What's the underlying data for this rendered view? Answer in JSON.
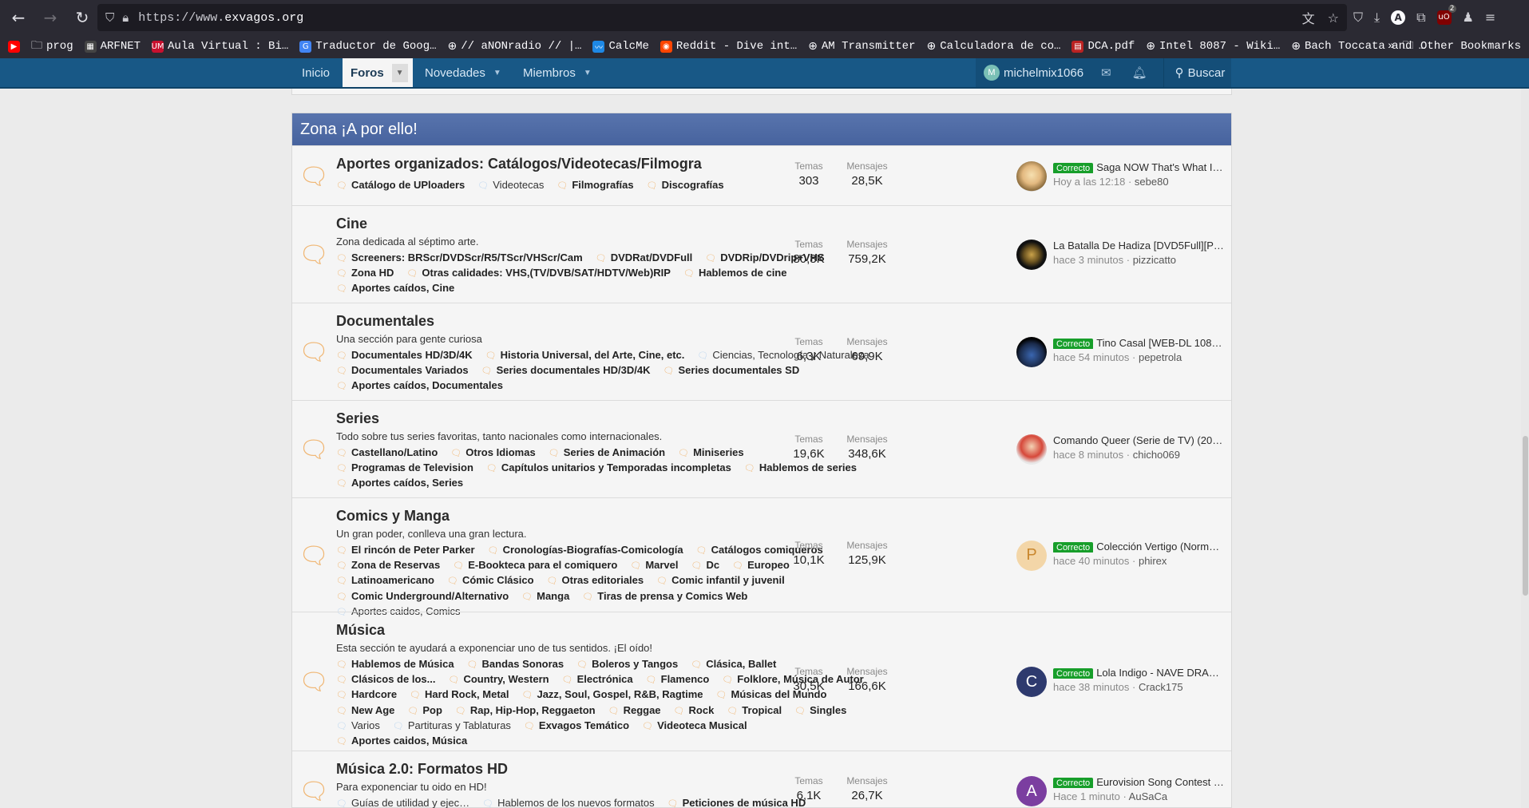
{
  "browser": {
    "url_prefix": "https://www.",
    "url_domain": "exvagos.org",
    "bookmarks": [
      "prog",
      "ARFNET",
      "Aula Virtual : Bi…",
      "Traductor de Goog…",
      "// aNONradio // |…",
      "CalcMe",
      "Reddit - Dive int…",
      "AM Transmitter",
      "Calculadora de co…",
      "DCA.pdf",
      "Intel 8087 - Wiki…",
      "Bach Toccata and …"
    ],
    "other_bookmarks": "Other Bookmarks",
    "ublock_count": "2"
  },
  "sitenav": {
    "home": "Inicio",
    "forums": "Foros",
    "news": "Novedades",
    "members": "Miembros",
    "username": "michelmix1066",
    "user_initial": "M",
    "search": "Buscar"
  },
  "block": {
    "title": "Zona ¡A por ello!",
    "stat_threads_label": "Temas",
    "stat_messages_label": "Mensajes",
    "prefix_label": "Correcto",
    "nodes": [
      {
        "title": "Aportes organizados: Catálogos/Videotecas/Filmogra",
        "desc": "",
        "subs": [
          [
            "Catálogo de UPloaders",
            true
          ],
          [
            "Videotecas",
            false
          ],
          [
            "Filmografías",
            true
          ],
          [
            "Discografías",
            true
          ]
        ],
        "threads": "303",
        "messages": "28,5K",
        "last_title": "Saga NOW That's What I…",
        "last_time": "Hoy a las 12:18",
        "last_user": "sebe80",
        "prefixed": true,
        "avatar": ""
      },
      {
        "title": "Cine",
        "desc": "Zona dedicada al séptimo arte.",
        "subs": [
          [
            "Screeners: BRScr/DVDScr/R5/TScr/VHScr/Cam",
            true
          ],
          [
            "DVDRat/DVDFull",
            true
          ],
          [
            "DVDRip/DVDrip+VHS",
            true
          ],
          [
            "Zona HD",
            true
          ],
          [
            "Otras calidades: VHS,(TV/DVB/SAT/HDTV/Web)RIP",
            true
          ],
          [
            "Hablemos de cine",
            true
          ],
          [
            "Aportes caídos, Cine",
            true
          ]
        ],
        "threads": "80,8K",
        "messages": "759,2K",
        "last_title": "La Batalla De Hadiza [DVD5Full][P…",
        "last_time": "hace 3 minutos",
        "last_user": "pizzicatto",
        "prefixed": false,
        "avatar": ""
      },
      {
        "title": "Documentales",
        "desc": "Una sección para gente curiosa",
        "subs": [
          [
            "Documentales HD/3D/4K",
            true
          ],
          [
            "Historia Universal, del Arte, Cine, etc.",
            true
          ],
          [
            "Ciencias, Tecnología y Naturaleza",
            false
          ],
          [
            "Documentales Variados",
            true
          ],
          [
            "Series documentales HD/3D/4K",
            true
          ],
          [
            "Series documentales SD",
            true
          ],
          [
            "Aportes caídos, Documentales",
            true
          ]
        ],
        "threads": "6,3K",
        "messages": "69,9K",
        "last_title": "Tino Casal [WEB-DL 108…",
        "last_time": "hace 54 minutos",
        "last_user": "pepetrola",
        "prefixed": true,
        "avatar": ""
      },
      {
        "title": "Series",
        "desc": "Todo sobre tus series favoritas, tanto nacionales como internacionales.",
        "subs": [
          [
            "Castellano/Latino",
            true
          ],
          [
            "Otros Idiomas",
            true
          ],
          [
            "Series de Animación",
            true
          ],
          [
            "Miniseries",
            true
          ],
          [
            "Programas de Television",
            true
          ],
          [
            "Capítulos unitarios y Temporadas incompletas",
            true
          ],
          [
            "Hablemos de series",
            true
          ],
          [
            "Aportes caídos, Series",
            true
          ]
        ],
        "threads": "19,6K",
        "messages": "348,6K",
        "last_title": "Comando Queer (Serie de TV) (20…",
        "last_time": "hace 8 minutos",
        "last_user": "chicho069",
        "prefixed": false,
        "avatar": ""
      },
      {
        "title": "Comics y Manga",
        "desc": "Un gran poder, conlleva una gran lectura.",
        "subs": [
          [
            "El rincón de Peter Parker",
            true
          ],
          [
            "Cronologías-Biografías-Comicología",
            true
          ],
          [
            "Catálogos comiqueros",
            true
          ],
          [
            "Zona de Reservas",
            true
          ],
          [
            "E-Bookteca para el comiquero",
            true
          ],
          [
            "Marvel",
            true
          ],
          [
            "Dc",
            true
          ],
          [
            "Europeo",
            true
          ],
          [
            "Latinoamericano",
            true
          ],
          [
            "Cómic Clásico",
            true
          ],
          [
            "Otras editoriales",
            true
          ],
          [
            "Comic infantil y juvenil",
            true
          ],
          [
            "Comic Underground/Alternativo",
            true
          ],
          [
            "Manga",
            true
          ],
          [
            "Tiras de prensa y Comics Web",
            true
          ],
          [
            "Aportes caidos, Comics",
            false
          ]
        ],
        "threads": "10,1K",
        "messages": "125,9K",
        "last_title": "Colección Vertigo (Norm…",
        "last_time": "hace 40 minutos",
        "last_user": "phirex",
        "prefixed": true,
        "avatar": "P"
      },
      {
        "title": "Música",
        "desc": "Esta sección te ayudará a exponenciar uno de tus sentidos. ¡El oído!",
        "subs": [
          [
            "Hablemos de Música",
            true
          ],
          [
            "Bandas Sonoras",
            true
          ],
          [
            "Boleros y Tangos",
            true
          ],
          [
            "Clásica, Ballet",
            true
          ],
          [
            "Clásicos de los...",
            true
          ],
          [
            "Country, Western",
            true
          ],
          [
            "Electrónica",
            true
          ],
          [
            "Flamenco",
            true
          ],
          [
            "Folklore, Música de Autor",
            true
          ],
          [
            "Hardcore",
            true
          ],
          [
            "Hard Rock, Metal",
            true
          ],
          [
            "Jazz, Soul, Gospel, R&B, Ragtime",
            true
          ],
          [
            "Músicas del Mundo",
            true
          ],
          [
            "New Age",
            true
          ],
          [
            "Pop",
            true
          ],
          [
            "Rap, Hip-Hop, Reggaeton",
            true
          ],
          [
            "Reggae",
            true
          ],
          [
            "Rock",
            true
          ],
          [
            "Tropical",
            true
          ],
          [
            "Singles",
            true
          ],
          [
            "Varios",
            false
          ],
          [
            "Partituras y Tablaturas",
            false
          ],
          [
            "Exvagos Temático",
            true
          ],
          [
            "Videoteca Musical",
            true
          ],
          [
            "Aportes caidos, Música",
            true
          ]
        ],
        "threads": "30,5K",
        "messages": "166,6K",
        "last_title": "Lola Indigo - NAVE DRA…",
        "last_time": "hace 38 minutos",
        "last_user": "Crack175",
        "prefixed": true,
        "avatar": "C"
      },
      {
        "title": "Música 2.0: Formatos HD",
        "desc": "Para exponenciar tu oido en HD!",
        "subs": [
          [
            "Guías de utilidad y ejec…",
            false
          ],
          [
            "Hablemos de los nuevos formatos",
            false
          ],
          [
            "Peticiones de música HD",
            true
          ]
        ],
        "threads": "6,1K",
        "messages": "26,7K",
        "last_title": "Eurovision Song Contest …",
        "last_time": "Hace 1 minuto",
        "last_user": "AuSaCa",
        "prefixed": true,
        "avatar": "A"
      }
    ]
  },
  "colors": {
    "nav": "#185886",
    "block_header": "#4a69a6",
    "prefix": "#179e2a",
    "node_icon": "#f0b673"
  }
}
